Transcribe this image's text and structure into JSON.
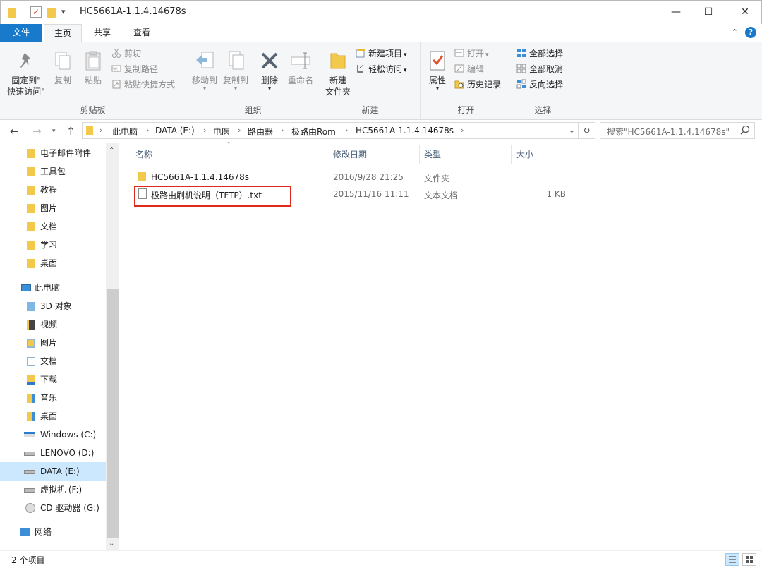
{
  "window": {
    "title": "HC5661A-1.1.4.14678s",
    "quick_access_dropdown": "▾",
    "minimize": "—",
    "maximize": "☐",
    "close": "✕"
  },
  "tabs": [
    "文件",
    "主页",
    "共享",
    "查看"
  ],
  "ribbon": {
    "clipboard": {
      "label": "剪贴板",
      "pin_line1": "固定到\"",
      "pin_line2": "快速访问\"",
      "copy": "复制",
      "paste": "粘贴",
      "cut": "剪切",
      "copy_path": "复制路径",
      "paste_shortcut": "粘贴快捷方式"
    },
    "organize": {
      "label": "组织",
      "move_to": "移动到",
      "copy_to": "复制到",
      "delete": "删除",
      "rename": "重命名"
    },
    "new": {
      "label": "新建",
      "new_folder_line1": "新建",
      "new_folder_line2": "文件夹",
      "new_item": "新建项目",
      "easy_access": "轻松访问"
    },
    "open": {
      "label": "打开",
      "properties": "属性",
      "open": "打开",
      "edit": "编辑",
      "history": "历史记录"
    },
    "select": {
      "label": "选择",
      "select_all": "全部选择",
      "select_none": "全部取消",
      "invert": "反向选择"
    }
  },
  "address": {
    "crumbs": [
      "此电脑",
      "DATA (E:)",
      "电医",
      "路由器",
      "极路由Rom",
      "HC5661A-1.1.4.14678s"
    ],
    "search_placeholder": "搜索\"HC5661A-1.1.4.14678s\""
  },
  "nav": {
    "quick": [
      "电子邮件附件",
      "工具包",
      "教程",
      "图片",
      "文档",
      "学习",
      "桌面"
    ],
    "this_pc": "此电脑",
    "pc_items": [
      "3D 对象",
      "视频",
      "图片",
      "文档",
      "下载",
      "音乐",
      "桌面",
      "Windows (C:)",
      "LENOVO (D:)",
      "DATA (E:)",
      "虚拟机 (F:)",
      "CD 驱动器 (G:)"
    ],
    "network": "网络"
  },
  "columns": {
    "name": "名称",
    "date": "修改日期",
    "type": "类型",
    "size": "大小"
  },
  "files": [
    {
      "name": "HC5661A-1.1.4.14678s",
      "date": "2016/9/28 21:25",
      "type": "文件夹",
      "size": ""
    },
    {
      "name": "极路由刷机说明（TFTP）.txt",
      "date": "2015/11/16 11:11",
      "type": "文本文档",
      "size": "1 KB"
    }
  ],
  "status": {
    "count": "2 个项目"
  },
  "colors": {
    "accent": "#1979ca",
    "folder": "#f3c94b",
    "highlight": "#e0281c",
    "selected_nav": "#cce8ff"
  }
}
